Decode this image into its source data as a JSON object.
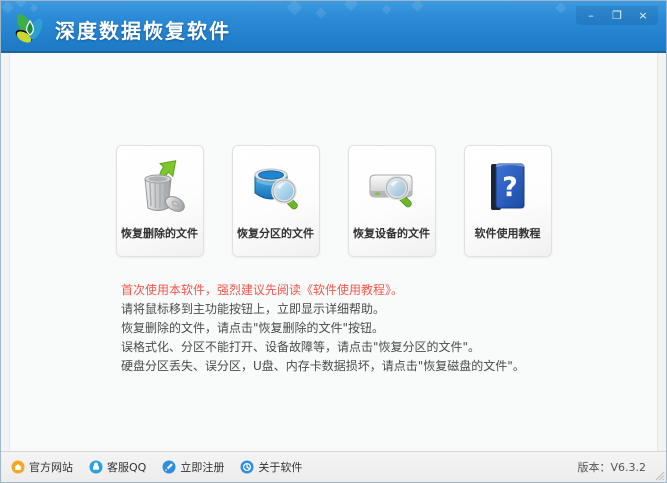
{
  "window": {
    "title": "深度数据恢复软件",
    "controls": {
      "minimize": "–",
      "restore": "❐",
      "close": "×"
    }
  },
  "cards": [
    {
      "label": "恢复删除的文件",
      "icon": "trash-recover-icon"
    },
    {
      "label": "恢复分区的文件",
      "icon": "partition-search-icon"
    },
    {
      "label": "恢复设备的文件",
      "icon": "device-search-icon"
    },
    {
      "label": "软件使用教程",
      "icon": "tutorial-book-icon"
    }
  ],
  "help": {
    "warning": "首次使用本软件，强烈建议先阅读《软件使用教程》。",
    "lines": [
      "请将鼠标移到主功能按钮上，立即显示详细帮助。",
      "恢复删除的文件，请点击\"恢复删除的文件\"按钮。",
      "误格式化、分区不能打开、设备故障等，请点击\"恢复分区的文件\"。",
      "硬盘分区丢失、误分区，U盘、内存卡数据损坏，请点击\"恢复磁盘的文件\"。"
    ]
  },
  "footer": {
    "links": [
      {
        "label": "官方网站",
        "icon": "home-icon"
      },
      {
        "label": "客服QQ",
        "icon": "qq-icon"
      },
      {
        "label": "立即注册",
        "icon": "register-icon"
      },
      {
        "label": "关于软件",
        "icon": "about-icon"
      }
    ],
    "version": "版本：V6.3.2"
  },
  "colors": {
    "titlebar_top": "#3d9ae0",
    "titlebar_bottom": "#1d79c6",
    "warning_red": "#f4574c",
    "accent_green": "#7dc62e",
    "accent_blue": "#2e8ee0",
    "home_orange": "#f5a623"
  }
}
